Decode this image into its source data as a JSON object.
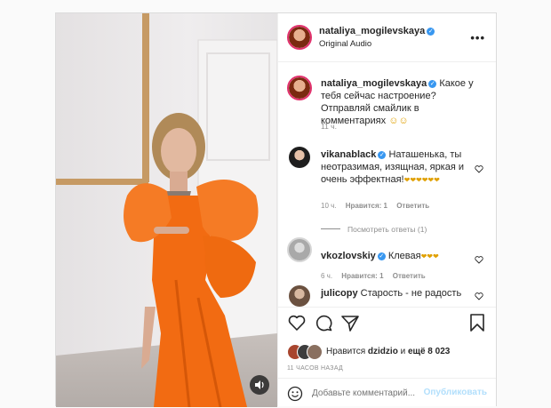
{
  "post": {
    "username": "nataliya_mogilevskaya",
    "audio": "Original Audio",
    "caption": "Какое у тебя сейчас настроение? Отправляй смайлик в комментариях",
    "caption_emoji": "☺☺",
    "caption_time": "11 ч."
  },
  "comments": [
    {
      "username": "vikanablack",
      "verified": true,
      "text": "Наташенька, ты неотразимая, изящная, яркая и очень эффектная!",
      "emoji": "❤❤❤❤❤❤",
      "time": "10 ч.",
      "likes": "Нравится: 1",
      "reply": "Ответить",
      "view_replies": "Посмотреть ответы (1)"
    },
    {
      "username": "vkozlovskiy",
      "verified": true,
      "text": "Клевая",
      "emoji": "❤❤❤",
      "time": "6 ч.",
      "likes": "Нравится: 1",
      "reply": "Ответить"
    },
    {
      "username": "julicopy",
      "verified": false,
      "text": "Старость - не радость"
    }
  ],
  "likes_line": {
    "prefix": "Нравится",
    "user": "dzidzio",
    "and": "и",
    "count": "ещё 8 023"
  },
  "timestamp": "11 ЧАСОВ НАЗАД",
  "composer": {
    "placeholder": "Добавьте комментарий...",
    "post_label": "Опубликовать"
  },
  "colors": {
    "dress": "#f26b12",
    "accent_blue": "#0095f6",
    "verified_blue": "#3897f0"
  }
}
